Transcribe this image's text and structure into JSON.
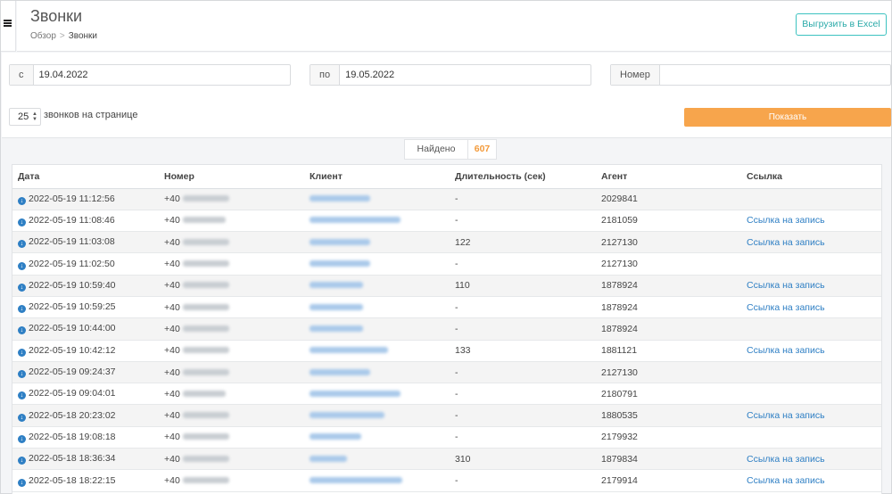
{
  "header": {
    "title": "Звонки",
    "breadcrumb": {
      "home": "Обзор",
      "separator": ">",
      "current": "Звонки"
    },
    "export_label": "Выгрузить в Excel"
  },
  "filters": {
    "from_label": "с",
    "from_value": "19.04.2022",
    "to_label": "по",
    "to_value": "19.05.2022",
    "number_label": "Номер",
    "number_value": "",
    "per_page_value": "25",
    "per_page_label": "звонков на странице",
    "show_label": "Показать"
  },
  "found": {
    "label": "Найдено",
    "count": "607"
  },
  "colors": {
    "accent_teal": "#3cc2c0",
    "button_orange": "#f7a54c",
    "link_blue": "#2e7fc4",
    "count_orange": "#f39a3a"
  },
  "table": {
    "columns": [
      "Дата",
      "Номер",
      "Клиент",
      "Длительность (сек)",
      "Агент",
      "Ссылка"
    ],
    "rows": [
      {
        "date": "2022-05-19 11:12:56",
        "prefix": "+40",
        "duration": "-",
        "agent": "2029841",
        "link": ""
      },
      {
        "date": "2022-05-19 11:08:46",
        "prefix": "+40",
        "duration": "-",
        "agent": "2181059",
        "link": "Ссылка на запись"
      },
      {
        "date": "2022-05-19 11:03:08",
        "prefix": "+40",
        "duration": "122",
        "agent": "2127130",
        "link": "Ссылка на запись"
      },
      {
        "date": "2022-05-19 11:02:50",
        "prefix": "+40",
        "duration": "-",
        "agent": "2127130",
        "link": ""
      },
      {
        "date": "2022-05-19 10:59:40",
        "prefix": "+40",
        "duration": "110",
        "agent": "1878924",
        "link": "Ссылка на запись"
      },
      {
        "date": "2022-05-19 10:59:25",
        "prefix": "+40",
        "duration": "-",
        "agent": "1878924",
        "link": "Ссылка на запись"
      },
      {
        "date": "2022-05-19 10:44:00",
        "prefix": "+40",
        "duration": "-",
        "agent": "1878924",
        "link": ""
      },
      {
        "date": "2022-05-19 10:42:12",
        "prefix": "+40",
        "duration": "133",
        "agent": "1881121",
        "link": "Ссылка на запись"
      },
      {
        "date": "2022-05-19 09:24:37",
        "prefix": "+40",
        "duration": "-",
        "agent": "2127130",
        "link": ""
      },
      {
        "date": "2022-05-19 09:04:01",
        "prefix": "+40",
        "duration": "-",
        "agent": "2180791",
        "link": ""
      },
      {
        "date": "2022-05-18 20:23:02",
        "prefix": "+40",
        "duration": "-",
        "agent": "1880535",
        "link": "Ссылка на запись"
      },
      {
        "date": "2022-05-18 19:08:18",
        "prefix": "+40",
        "duration": "-",
        "agent": "2179932",
        "link": ""
      },
      {
        "date": "2022-05-18 18:36:34",
        "prefix": "+40",
        "duration": "310",
        "agent": "1879834",
        "link": "Ссылка на запись"
      },
      {
        "date": "2022-05-18 18:22:15",
        "prefix": "+40",
        "duration": "-",
        "agent": "2179914",
        "link": "Ссылка на запись"
      }
    ]
  }
}
